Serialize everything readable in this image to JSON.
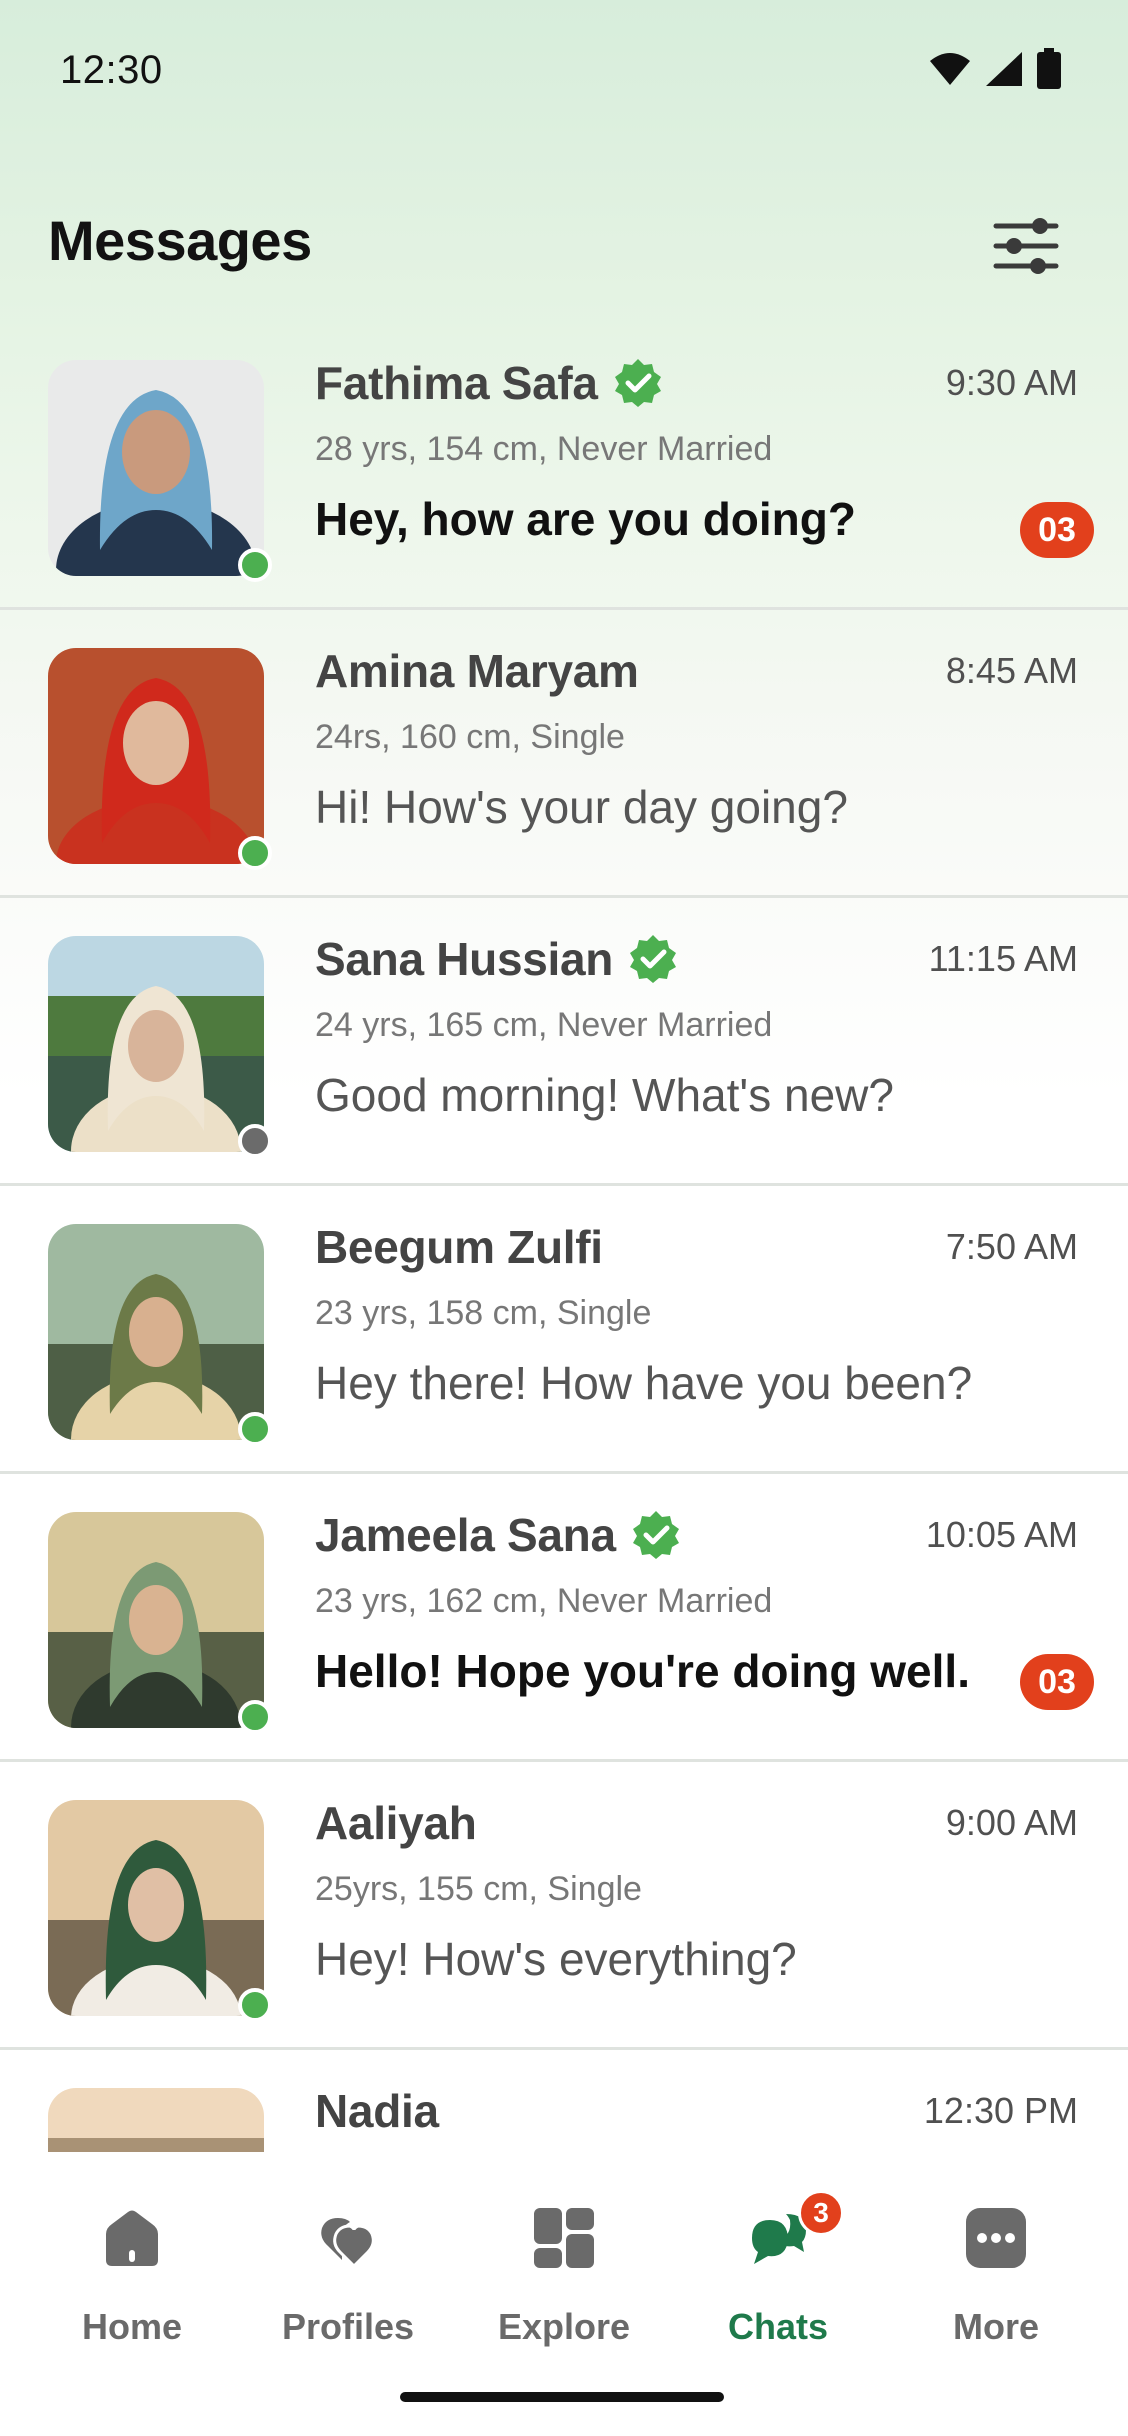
{
  "status_bar": {
    "time": "12:30"
  },
  "header": {
    "title": "Messages"
  },
  "colors": {
    "accent": "#1f7a4b",
    "badge": "#e2401c",
    "online": "#4caf50",
    "verified": "#4caf50"
  },
  "chats": [
    {
      "name": "Fathima Safa",
      "verified": true,
      "time": "9:30 AM",
      "meta": "28 yrs, 154 cm, Never Married",
      "message": "Hey, how are you doing?",
      "unread": "03",
      "online": true
    },
    {
      "name": "Amina Maryam",
      "verified": false,
      "time": "8:45 AM",
      "meta": "24rs, 160 cm, Single",
      "message": "Hi! How's your day going?",
      "unread": "",
      "online": true
    },
    {
      "name": "Sana Hussian",
      "verified": true,
      "time": "11:15 AM",
      "meta": "24 yrs, 165 cm, Never Married",
      "message": "Good morning! What's new?",
      "unread": "",
      "online": false
    },
    {
      "name": "Beegum Zulfi",
      "verified": false,
      "time": "7:50 AM",
      "meta": "23 yrs, 158 cm, Single",
      "message": "Hey there! How have you been?",
      "unread": "",
      "online": true
    },
    {
      "name": "Jameela Sana",
      "verified": true,
      "time": "10:05 AM",
      "meta": "23 yrs, 162 cm, Never Married",
      "message": "Hello! Hope you're doing well.",
      "unread": "03",
      "online": true
    },
    {
      "name": "Aaliyah",
      "verified": false,
      "time": "9:00 AM",
      "meta": "25yrs, 155 cm, Single",
      "message": "Hey! How's everything?",
      "unread": "",
      "online": true
    },
    {
      "name": "Nadia",
      "verified": false,
      "time": "12:30 PM",
      "meta": "",
      "message": "",
      "unread": "",
      "online": true
    }
  ],
  "nav": {
    "items": [
      {
        "label": "Home",
        "icon": "home-icon"
      },
      {
        "label": "Profiles",
        "icon": "heart-icon"
      },
      {
        "label": "Explore",
        "icon": "explore-grid-icon"
      },
      {
        "label": "Chats",
        "icon": "chat-bubbles-icon",
        "badge": "3",
        "active": true
      },
      {
        "label": "More",
        "icon": "more-dots-icon"
      }
    ]
  }
}
